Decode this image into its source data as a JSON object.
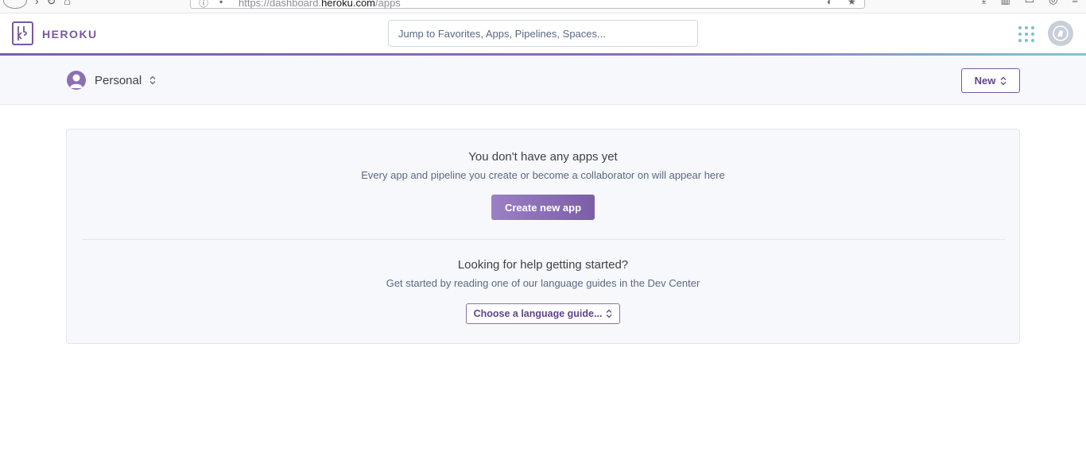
{
  "browser": {
    "url_prefix": "https://dashboard.",
    "url_domain": "heroku.com",
    "url_path": "/apps"
  },
  "header": {
    "brand": "HEROKU",
    "search_placeholder": "Jump to Favorites, Apps, Pipelines, Spaces..."
  },
  "subheader": {
    "team_label": "Personal",
    "new_button_label": "New"
  },
  "empty_state": {
    "title": "You don't have any apps yet",
    "subtitle": "Every app and pipeline you create or become a collaborator on will appear here",
    "create_button_label": "Create new app"
  },
  "help": {
    "title": "Looking for help getting started?",
    "subtitle": "Get started by reading one of our language guides in the Dev Center",
    "language_select_label": "Choose a language guide..."
  },
  "colors": {
    "brand_purple": "#79589f",
    "accent_teal": "#79c1d0"
  }
}
